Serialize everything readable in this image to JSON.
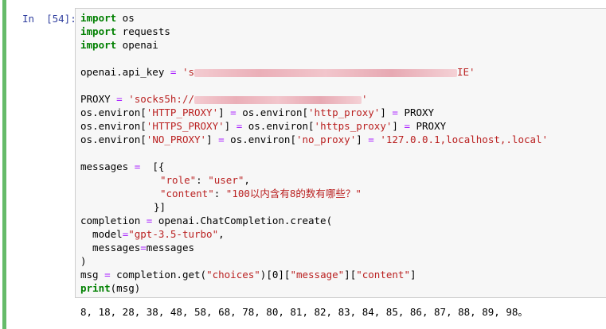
{
  "prompt": "In  [54]:",
  "code": {
    "l1_kw": "import",
    "l1_rest": " os",
    "l2_kw": "import",
    "l2_rest": " requests",
    "l3_kw": "import",
    "l3_rest": " openai",
    "l5_lhs": "openai.api_key ",
    "l5_eq": "=",
    "l5_str_start": " 's",
    "l5_str_end": "IE'",
    "l7_lhs": "PROXY ",
    "l7_eq": "=",
    "l7_str_start": " 'socks5h://",
    "l7_str_end": "'",
    "l8_a": "os.environ[",
    "l8_b": "'HTTP_PROXY'",
    "l8_c": "] ",
    "l8_eq1": "=",
    "l8_d": " os.environ[",
    "l8_e": "'http_proxy'",
    "l8_f": "] ",
    "l8_eq2": "=",
    "l8_g": " PROXY",
    "l9_b": "'HTTPS_PROXY'",
    "l9_e": "'https_proxy'",
    "l10_b": "'NO_PROXY'",
    "l10_e": "'no_proxy'",
    "l10_g_str": " '127.0.0.1,localhost,.local'",
    "l12_lhs": "messages ",
    "l12_eq": "=",
    "l12_rest": "  [{",
    "l13_key": "\"role\"",
    "l13_colon": ": ",
    "l13_val": "\"user\"",
    "l13_end": ",",
    "l14_key": "\"content\"",
    "l14_colon": ": ",
    "l14_val": "\"100以内含有8的数有哪些？\"",
    "l15": "}]",
    "l16_lhs": "completion ",
    "l16_eq": "=",
    "l16_rest": " openai.ChatCompletion.create(",
    "l17_a": "  model",
    "l17_eq": "=",
    "l17_str": "\"gpt-3.5-turbo\"",
    "l17_end": ",",
    "l18_a": "  messages",
    "l18_eq": "=",
    "l18_b": "messages",
    "l19": ")",
    "l20_lhs": "msg ",
    "l20_eq": "=",
    "l20_a": " completion.get(",
    "l20_s1": "\"choices\"",
    "l20_b": ")[0][",
    "l20_s2": "\"message\"",
    "l20_c": "][",
    "l20_s3": "\"content\"",
    "l20_d": "]",
    "l21_kw": "print",
    "l21_rest": "(msg)"
  },
  "output": "8, 18, 28, 38, 48, 58, 68, 78, 80, 81, 82, 83, 84, 85, 86, 87, 88, 89, 98。"
}
